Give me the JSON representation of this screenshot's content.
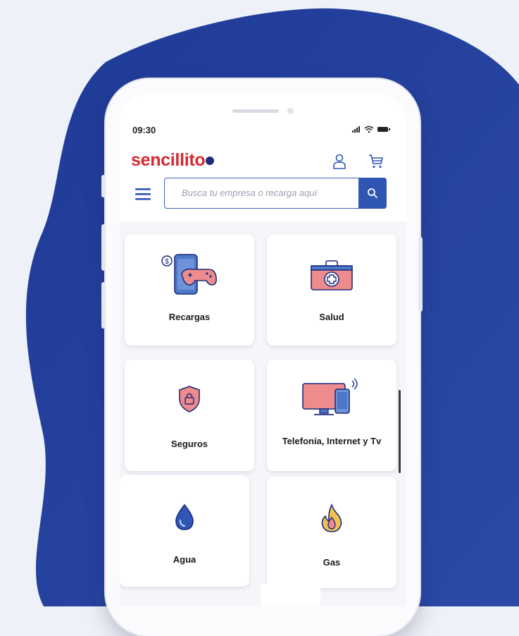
{
  "status_bar": {
    "time": "09:30"
  },
  "header": {
    "brand": "sencillito",
    "search": {
      "placeholder": "Busca tu empresa o recarga aquí",
      "value": ""
    }
  },
  "categories": [
    {
      "label": "Recargas",
      "icon": "phone-gamepad-icon"
    },
    {
      "label": "Salud",
      "icon": "medical-kit-icon"
    },
    {
      "label": "Seguros",
      "icon": "shield-lock-icon"
    },
    {
      "label": "Telefonía, Internet y Tv",
      "icon": "tv-phone-icon"
    },
    {
      "label": "Agua",
      "icon": "water-drop-icon"
    },
    {
      "label": "Gas",
      "icon": "flame-icon"
    }
  ],
  "colors": {
    "brand_red": "#d7282f",
    "brand_blue": "#2f56b5",
    "background_blob": "#243f9a"
  }
}
